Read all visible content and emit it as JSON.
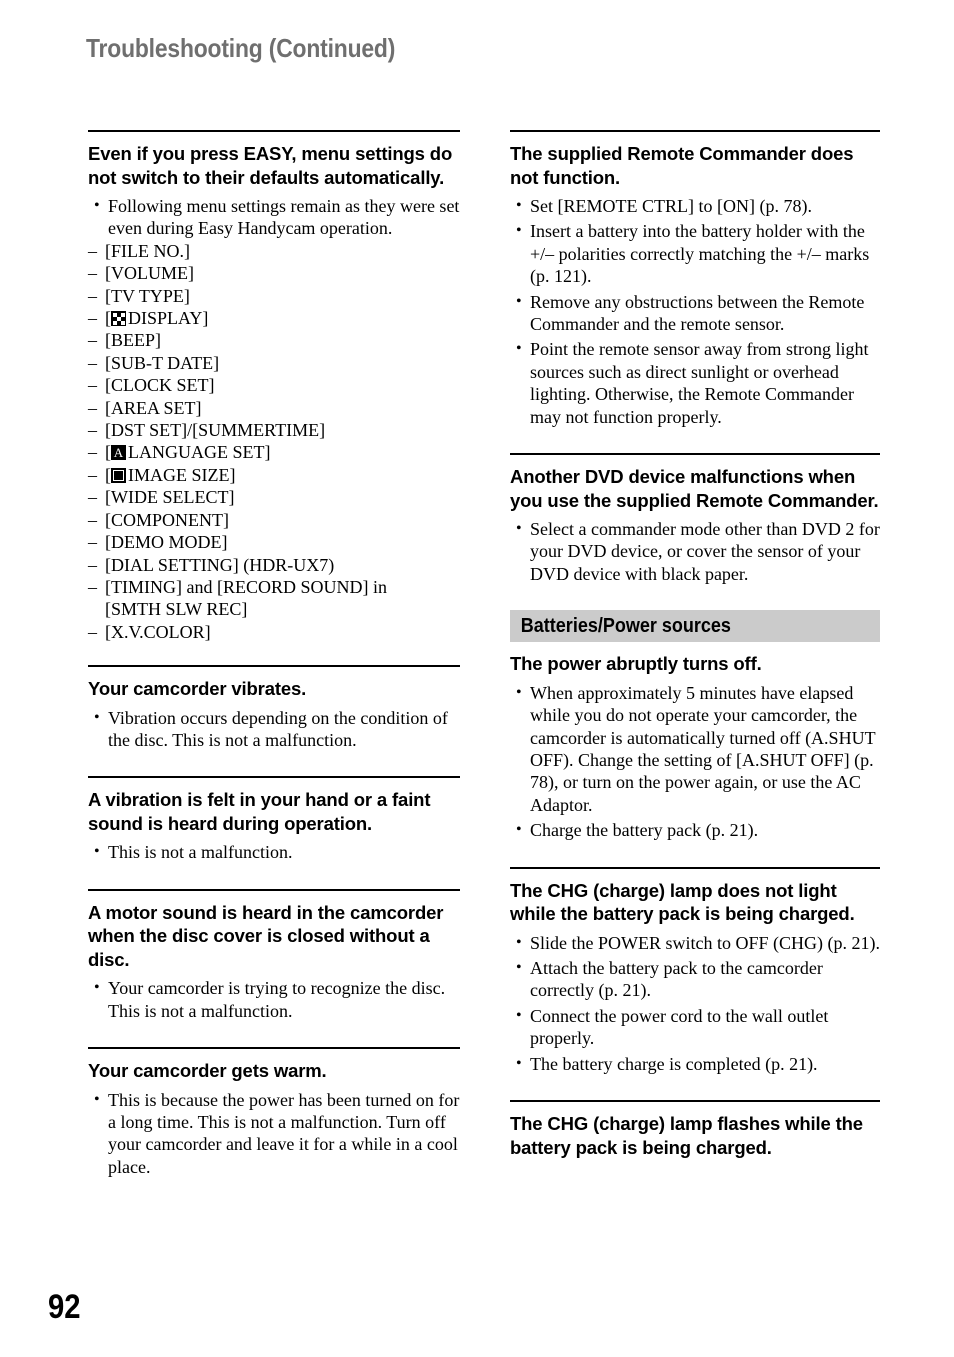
{
  "page": {
    "running_head": "Troubleshooting (Continued)",
    "folio": "92"
  },
  "left_column": {
    "blocks": [
      {
        "heading": "Even if you press EASY, menu settings do not switch to their defaults automatically.",
        "answers": [
          "Following menu settings remain as they were set even during Easy Handycam operation."
        ],
        "dash_items": [
          {
            "text": "[FILE NO.]"
          },
          {
            "text": "[VOLUME]"
          },
          {
            "text": "[TV TYPE]"
          },
          {
            "icon": "checkerboard-display-icon",
            "pre": "[",
            "text": "DISPLAY]"
          },
          {
            "text": "[BEEP]"
          },
          {
            "text": "[SUB-T DATE]"
          },
          {
            "text": "[CLOCK SET]"
          },
          {
            "text": "[AREA SET]"
          },
          {
            "text": "[DST SET]/[SUMMERTIME]"
          },
          {
            "icon": "language-a-icon",
            "pre": "[",
            "text": "LANGUAGE SET]"
          },
          {
            "icon": "image-size-icon",
            "pre": "[",
            "text": "IMAGE SIZE]"
          },
          {
            "text": "[WIDE SELECT]"
          },
          {
            "text": "[COMPONENT]"
          },
          {
            "text": "[DEMO MODE]"
          },
          {
            "text": "[DIAL SETTING] (HDR-UX7)"
          },
          {
            "text": "[TIMING] and [RECORD SOUND] in",
            "cont": "[SMTH SLW REC]"
          },
          {
            "text": "[X.V.COLOR]"
          }
        ]
      },
      {
        "heading": "Your camcorder vibrates.",
        "answers": [
          "Vibration occurs depending on the condition of the disc. This is not a malfunction."
        ]
      },
      {
        "heading": "A vibration is felt in your hand or a faint sound is heard during operation.",
        "answers": [
          "This is not a malfunction."
        ]
      },
      {
        "heading": "A motor sound is heard in the camcorder when the disc cover is closed without a disc.",
        "answers": [
          "Your camcorder is trying to recognize the disc. This is not a malfunction."
        ]
      },
      {
        "heading": "Your camcorder gets warm.",
        "answers": [
          "This is because the power has been turned on for a long time. This is not a malfunction. Turn off your camcorder and leave it for a while in a cool place."
        ]
      }
    ]
  },
  "right_column": {
    "blocks": [
      {
        "heading": "The supplied Remote Commander does not function.",
        "answers": [
          "Set [REMOTE CTRL] to [ON] (p. 78).",
          "Insert a battery into the battery holder with the +/– polarities correctly matching the +/– marks (p. 121).",
          "Remove any obstructions between the Remote Commander and the remote sensor.",
          "Point the remote sensor away from strong light sources such as direct sunlight or overhead lighting. Otherwise, the Remote Commander may not function properly."
        ]
      },
      {
        "heading": "Another DVD device malfunctions when you use the supplied Remote Commander.",
        "answers": [
          "Select a commander mode other than DVD 2 for your DVD device, or cover the sensor of your DVD device with black paper."
        ]
      }
    ],
    "section_banner": "Batteries/Power sources",
    "section_blocks": [
      {
        "heading": "The power abruptly turns off.",
        "answers": [
          "When approximately 5 minutes have elapsed while you do not operate your camcorder, the camcorder is automatically turned off (A.SHUT OFF). Change the setting of [A.SHUT OFF] (p. 78), or turn on the power again, or use the AC Adaptor.",
          "Charge the battery pack (p. 21)."
        ]
      },
      {
        "heading": "The CHG (charge) lamp does not light while the battery pack is being charged.",
        "answers": [
          "Slide the POWER switch to OFF (CHG) (p. 21).",
          "Attach the battery pack to the camcorder correctly (p. 21).",
          "Connect the power cord to the wall outlet properly.",
          "The battery charge is completed (p. 21)."
        ]
      },
      {
        "heading": "The CHG (charge) lamp flashes while the battery pack is being charged.",
        "answers": []
      }
    ]
  }
}
